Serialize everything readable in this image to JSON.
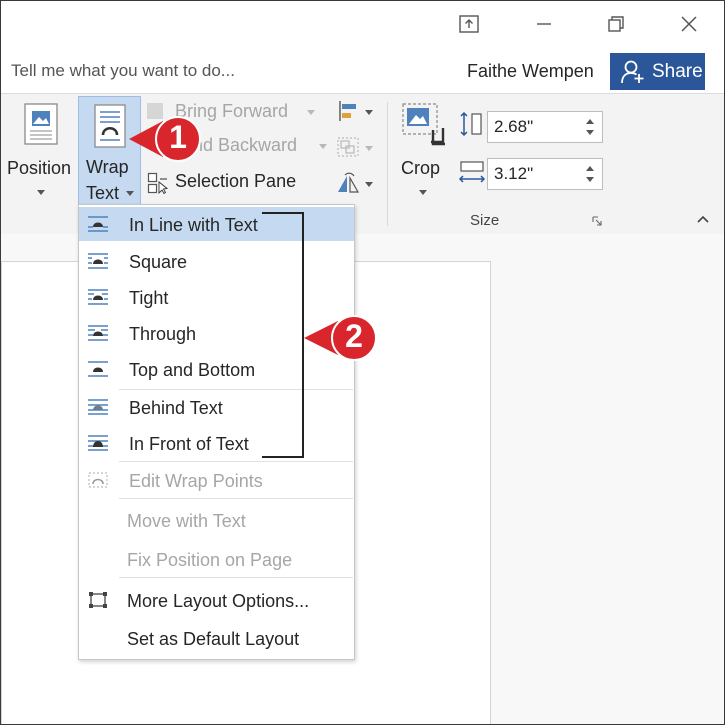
{
  "window": {
    "user_name": "Faithe Wempen",
    "share_label": "Share",
    "tell_me_placeholder": "Tell me what you want to do..."
  },
  "ribbon": {
    "position_label": "Position",
    "wrap_text_label_line1": "Wrap",
    "wrap_text_label_line2": "Text",
    "bring_forward_label": "Bring Forward",
    "send_backward_label": "nd Backward",
    "selection_pane_label": "Selection Pane",
    "crop_label": "Crop",
    "size_group_label": "Size",
    "height_value": "2.68\"",
    "width_value": "3.12\""
  },
  "wrap_menu": {
    "items": [
      {
        "label": "In Line with Text",
        "highlighted": true,
        "enabled": true
      },
      {
        "label": "Square",
        "enabled": true
      },
      {
        "label": "Tight",
        "enabled": true
      },
      {
        "label": "Through",
        "enabled": true
      },
      {
        "label": "Top and Bottom",
        "enabled": true
      },
      {
        "label": "Behind Text",
        "enabled": true
      },
      {
        "label": "In Front of Text",
        "enabled": true
      },
      {
        "label": "Edit Wrap Points",
        "enabled": false
      },
      {
        "label": "Move with Text",
        "enabled": false
      },
      {
        "label": "Fix Position on Page",
        "enabled": false
      },
      {
        "label": "More Layout Options...",
        "enabled": true
      },
      {
        "label": "Set as Default Layout",
        "enabled": true
      }
    ]
  },
  "callouts": {
    "step1": "1",
    "step2": "2",
    "color": "#d9262c"
  },
  "colors": {
    "accent": "#2b579a",
    "highlight": "#c5d9f1"
  }
}
